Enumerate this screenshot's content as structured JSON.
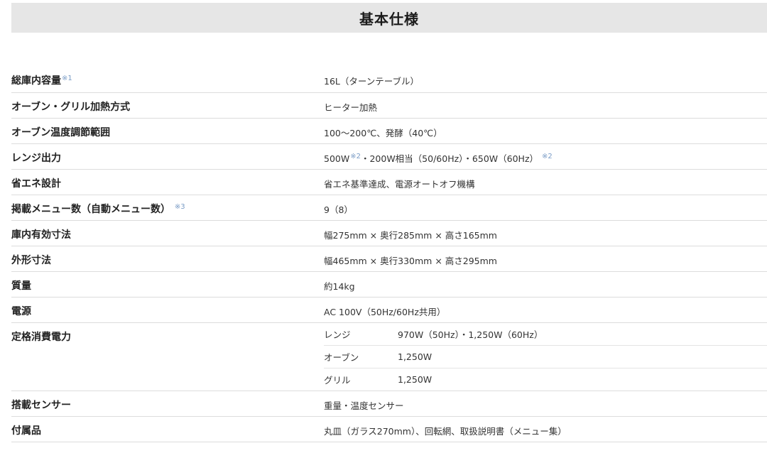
{
  "header": {
    "title": "基本仕様"
  },
  "specs": {
    "capacity": {
      "label": "総庫内容量",
      "note": "※1",
      "value": "16L（ターンテーブル）"
    },
    "heating": {
      "label": "オーブン・グリル加熱方式",
      "value": "ヒーター加熱"
    },
    "temp": {
      "label": "オーブン温度調節範囲",
      "value": "100～200℃、発酵（40℃）"
    },
    "output": {
      "label": "レンジ出力",
      "value_a": "500W",
      "note_a": "※2",
      "value_b": "・200W相当（50/60Hz）・650W（60Hz）",
      "note_b": "※2"
    },
    "eco": {
      "label": "省エネ設計",
      "value": "省エネ基準達成、電源オートオフ機構"
    },
    "menu": {
      "label": "掲載メニュー数（自動メニュー数）",
      "note": "※3",
      "value": "9（8）"
    },
    "inner": {
      "label": "庫内有効寸法",
      "value": "幅275mm × 奥行285mm × 高さ165mm"
    },
    "outer": {
      "label": "外形寸法",
      "value": "幅465mm × 奥行330mm × 高さ295mm"
    },
    "weight": {
      "label": "質量",
      "value": "約14kg"
    },
    "power": {
      "label": "電源",
      "value": "AC 100V（50Hz/60Hz共用）"
    },
    "consumption": {
      "label": "定格消費電力",
      "rows": [
        {
          "key": "レンジ",
          "value": "970W（50Hz）・1,250W（60Hz）"
        },
        {
          "key": "オーブン",
          "value": "1,250W"
        },
        {
          "key": "グリル",
          "value": "1,250W"
        }
      ]
    },
    "sensor": {
      "label": "搭載センサー",
      "value": "重量・温度センサー"
    },
    "accessories": {
      "label": "付属品",
      "value": "丸皿（ガラス270mm）、回転網、取扱説明書（メニュー集）"
    }
  }
}
